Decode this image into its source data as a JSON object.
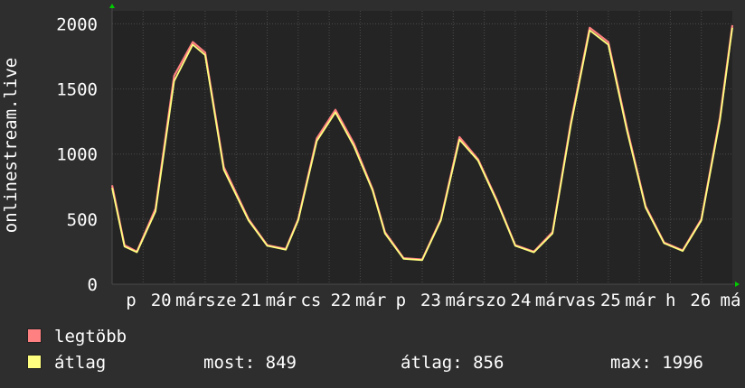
{
  "y_axis_label": "onlinestream.live",
  "legend": [
    {
      "label": "legtöbb",
      "color": "#ff8080"
    },
    {
      "label": "átlag",
      "color": "#ffff80"
    }
  ],
  "stats": {
    "current": "most: 849",
    "average": "átlag: 856",
    "max": "max: 1996"
  },
  "colors": {
    "background": "#2e2e2e",
    "plot": "#242424",
    "grid": "#4a4a4a",
    "axis_arrow": "#00cc00"
  },
  "chart_data": {
    "type": "line",
    "ylim": [
      0,
      2100
    ],
    "yticks": [
      0,
      500,
      1000,
      1500,
      2000
    ],
    "x_tick_labels": [
      "p",
      "20",
      "már",
      "sze",
      "21",
      "már",
      "cs",
      "22",
      "már",
      "p",
      "23",
      "már",
      "szo",
      "24",
      "már",
      "vas",
      "25",
      "már",
      "h",
      "26",
      "má"
    ],
    "series": [
      {
        "name": "legtöbb",
        "color": "#ff8080",
        "x": [
          0.0,
          0.02,
          0.04,
          0.07,
          0.1,
          0.13,
          0.15,
          0.18,
          0.22,
          0.25,
          0.28,
          0.3,
          0.33,
          0.36,
          0.39,
          0.42,
          0.44,
          0.47,
          0.5,
          0.53,
          0.56,
          0.59,
          0.62,
          0.65,
          0.68,
          0.71,
          0.74,
          0.77,
          0.8,
          0.83,
          0.86,
          0.89,
          0.92,
          0.95,
          0.98,
          1.0
        ],
        "y": [
          760,
          300,
          250,
          580,
          1600,
          1860,
          1780,
          900,
          500,
          300,
          270,
          500,
          1120,
          1340,
          1080,
          730,
          400,
          200,
          190,
          500,
          1130,
          960,
          650,
          300,
          250,
          400,
          1250,
          1970,
          1860,
          1200,
          600,
          320,
          260,
          500,
          1280,
          1990
        ]
      },
      {
        "name": "átlag",
        "color": "#ffff80",
        "x": [
          0.0,
          0.02,
          0.04,
          0.07,
          0.1,
          0.13,
          0.15,
          0.18,
          0.22,
          0.25,
          0.28,
          0.3,
          0.33,
          0.36,
          0.39,
          0.42,
          0.44,
          0.47,
          0.5,
          0.53,
          0.56,
          0.59,
          0.62,
          0.65,
          0.68,
          0.71,
          0.74,
          0.77,
          0.8,
          0.83,
          0.86,
          0.89,
          0.92,
          0.95,
          0.98,
          1.0
        ],
        "y": [
          740,
          290,
          245,
          560,
          1560,
          1840,
          1760,
          880,
          490,
          295,
          265,
          490,
          1100,
          1320,
          1060,
          720,
          390,
          195,
          185,
          490,
          1110,
          950,
          640,
          295,
          245,
          390,
          1230,
          1950,
          1840,
          1180,
          590,
          315,
          255,
          490,
          1260,
          1970
        ]
      }
    ]
  }
}
